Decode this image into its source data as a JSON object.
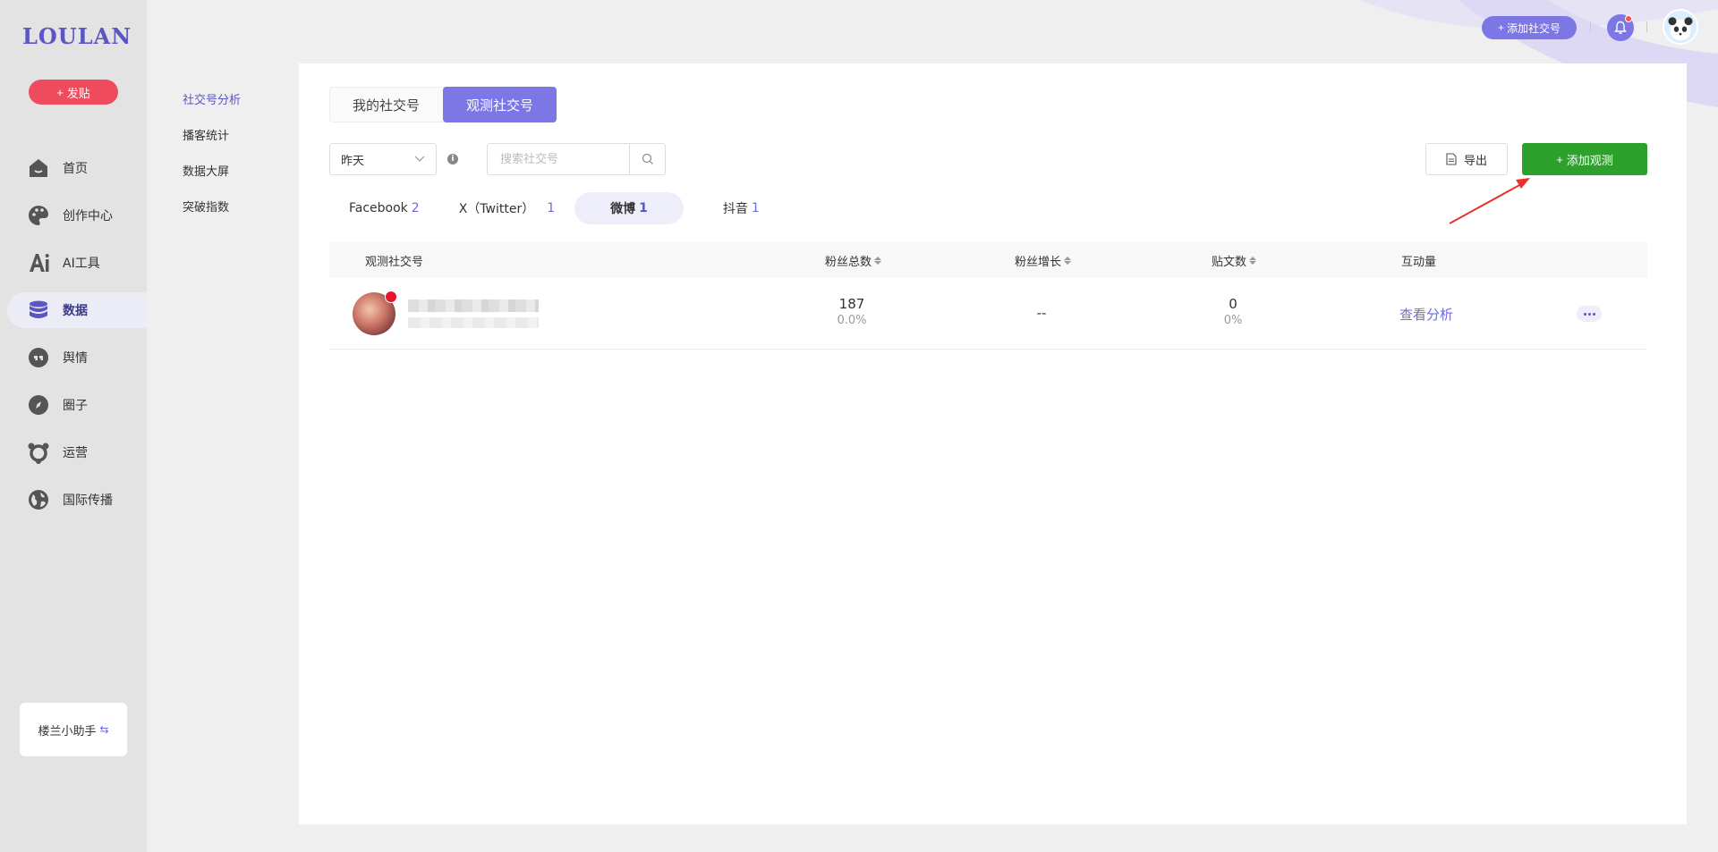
{
  "logo": "LOULAN",
  "post_button": "发贴",
  "nav": [
    {
      "label": "首页",
      "icon": "home-icon"
    },
    {
      "label": "创作中心",
      "icon": "palette-icon"
    },
    {
      "label": "AI工具",
      "icon": "ai-icon"
    },
    {
      "label": "数据",
      "icon": "database-icon"
    },
    {
      "label": "舆情",
      "icon": "quote-icon"
    },
    {
      "label": "圈子",
      "icon": "compass-icon"
    },
    {
      "label": "运营",
      "icon": "hub-icon"
    },
    {
      "label": "国际传播",
      "icon": "globe-icon"
    }
  ],
  "assistant": "楼兰小助手",
  "subnav": [
    "社交号分析",
    "播客统计",
    "数据大屏",
    "突破指数"
  ],
  "header": {
    "add_social": "添加社交号"
  },
  "tabs": [
    "我的社交号",
    "观测社交号"
  ],
  "filters": {
    "date": "昨天",
    "search_placeholder": "搜索社交号",
    "export": "导出",
    "add_observe": "添加观测"
  },
  "platforms": [
    {
      "name": "Facebook",
      "count": "2"
    },
    {
      "name": "X（Twitter）",
      "count": "1"
    },
    {
      "name": "微博",
      "count": "1"
    },
    {
      "name": "抖音",
      "count": "1"
    }
  ],
  "table": {
    "headers": [
      "观测社交号",
      "粉丝总数",
      "粉丝增长",
      "贴文数",
      "互动量"
    ],
    "rows": [
      {
        "fans": "187",
        "fans_pct": "0.0%",
        "growth": "--",
        "posts": "0",
        "posts_pct": "0%",
        "action": "查看分析"
      }
    ]
  },
  "colors": {
    "accent": "#7d77e6",
    "danger": "#ee4b5e",
    "success": "#2ea12c",
    "link": "#6c6ce0"
  }
}
